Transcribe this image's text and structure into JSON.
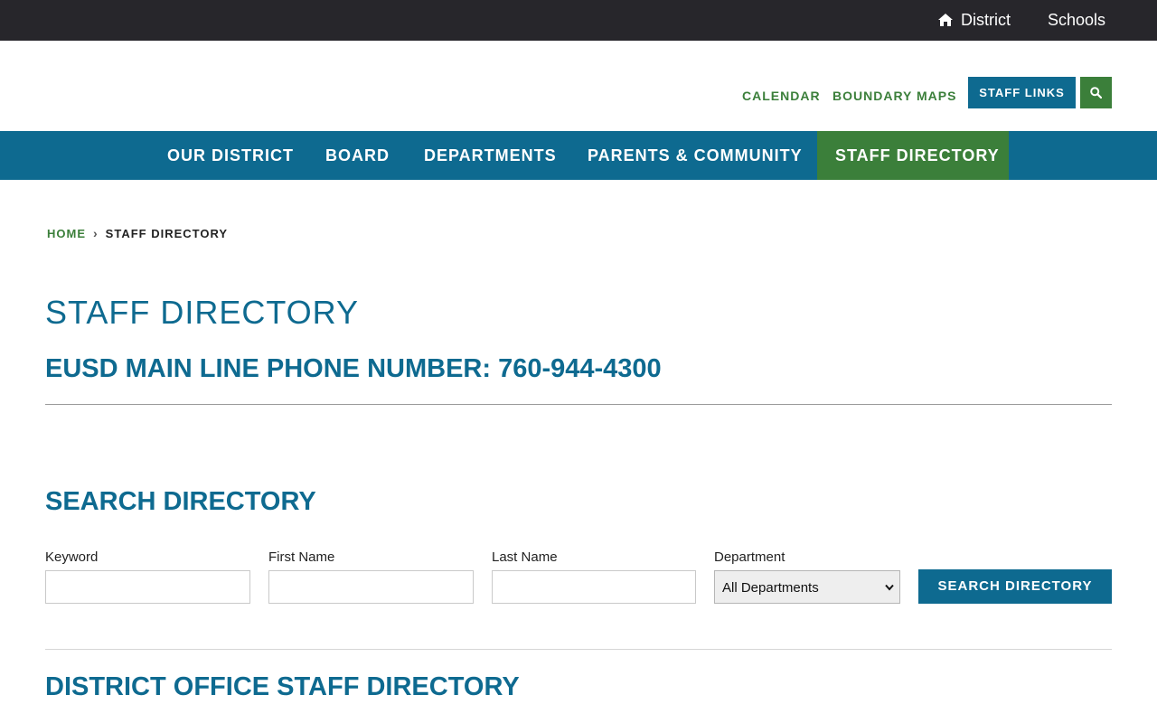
{
  "topbar": {
    "district_label": "District",
    "schools_label": "Schools",
    "home_icon": "home-icon"
  },
  "utility": {
    "calendar": "CALENDAR",
    "boundary_maps": "BOUNDARY MAPS",
    "staff_links": "STAFF LINKS",
    "search_icon": "search-icon"
  },
  "nav": {
    "items": [
      {
        "label": "OUR DISTRICT"
      },
      {
        "label": "BOARD"
      },
      {
        "label": "DEPARTMENTS"
      },
      {
        "label": "PARENTS & COMMUNITY"
      },
      {
        "label": "STAFF DIRECTORY",
        "active": true
      }
    ]
  },
  "breadcrumb": {
    "home": "HOME",
    "separator": "›",
    "current": "STAFF DIRECTORY"
  },
  "page": {
    "title": "STAFF DIRECTORY",
    "phone_heading": "EUSD MAIN LINE PHONE NUMBER: 760-944-4300",
    "search_heading": "SEARCH DIRECTORY",
    "district_heading": "DISTRICT OFFICE STAFF DIRECTORY"
  },
  "search_form": {
    "keyword_label": "Keyword",
    "keyword_value": "",
    "first_name_label": "First Name",
    "first_name_value": "",
    "last_name_label": "Last Name",
    "last_name_value": "",
    "department_label": "Department",
    "department_selected": "All Departments",
    "submit_label": "SEARCH DIRECTORY"
  },
  "colors": {
    "topbar_bg": "#27262b",
    "primary_blue": "#0e6a90",
    "accent_green": "#3b7f3a"
  }
}
